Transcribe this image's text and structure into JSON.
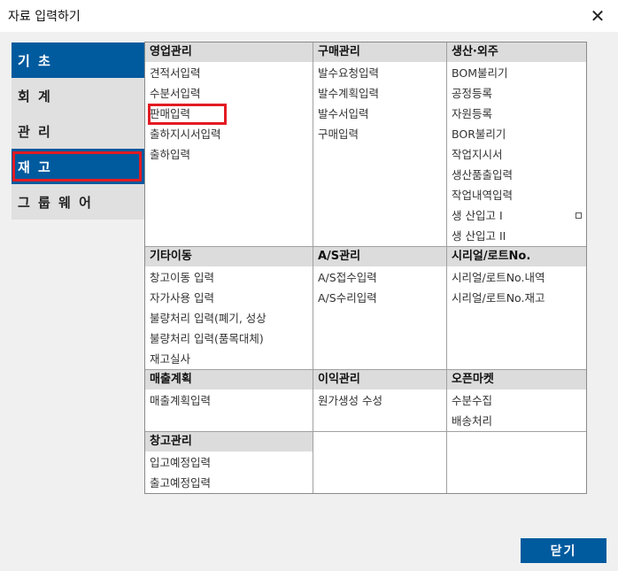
{
  "window": {
    "title": "자료 입력하기",
    "close_glyph": "✕"
  },
  "sidebar": {
    "items": [
      {
        "label": "기 초"
      },
      {
        "label": "회 계"
      },
      {
        "label": "관 리"
      },
      {
        "label": "재 고"
      },
      {
        "label": "그 룹 웨 어"
      }
    ]
  },
  "grid": {
    "sales": {
      "header": "영업관리",
      "items": [
        "견적서입력",
        "수분서입력",
        "판매입력",
        "출하지시서입력",
        "출하입력"
      ]
    },
    "purchase": {
      "header": "구매관리",
      "items": [
        "발수요청입력",
        "발수계획입력",
        "발수서입력",
        "구매입력"
      ]
    },
    "production": {
      "header": "생산·외주",
      "items": [
        "BOM불리기",
        "공정등록",
        "자원등록",
        "BOR불리기",
        "작업지시서",
        "생산품출입력",
        "작업내역입력",
        "생 산입고 I",
        "생 산입고 II"
      ]
    },
    "other_move": {
      "header": "기타이동",
      "items": [
        "창고이동 입력",
        "자가사용 입력",
        "불량처리 입력(폐기, 성상",
        "불량처리 입력(품목대체)",
        "재고실사"
      ]
    },
    "as": {
      "header": "A/S관리",
      "items": [
        "A/S접수입력",
        "A/S수리입력"
      ]
    },
    "serial": {
      "header": "시리얼/로트No.",
      "items": [
        "시리얼/로트No.내역",
        "시리얼/로트No.재고"
      ]
    },
    "sales_plan": {
      "header": "매출계획",
      "items": [
        "매출계획입력"
      ]
    },
    "profit": {
      "header": "이익관리",
      "items": [
        "원가생성 수성"
      ]
    },
    "open_market": {
      "header": "오픈마켓",
      "items": [
        "수분수집",
        "배송처리"
      ]
    },
    "warehouse": {
      "header": "창고관리",
      "items": [
        "입고예정입력",
        "출고예정입력"
      ]
    }
  },
  "footer": {
    "close_label": "닫기"
  },
  "colors": {
    "accent": "#005a9e",
    "highlight": "#e21b23"
  }
}
